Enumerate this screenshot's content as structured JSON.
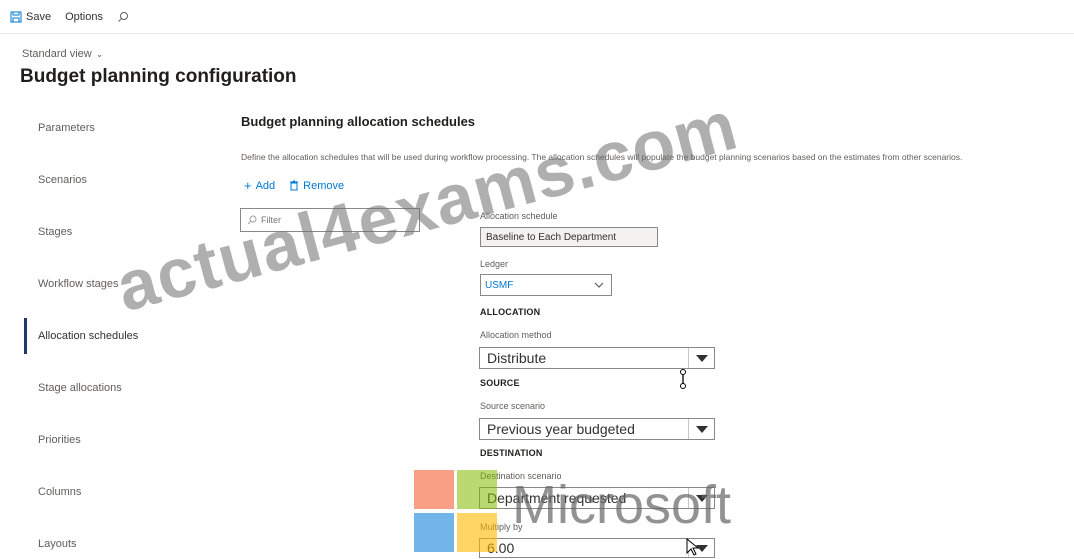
{
  "toolbar": {
    "save_label": "Save",
    "options_label": "Options"
  },
  "header": {
    "view_label": "Standard view",
    "title": "Budget planning configuration"
  },
  "nav": {
    "items": [
      {
        "label": "Parameters"
      },
      {
        "label": "Scenarios"
      },
      {
        "label": "Stages"
      },
      {
        "label": "Workflow stages"
      },
      {
        "label": "Allocation schedules"
      },
      {
        "label": "Stage allocations"
      },
      {
        "label": "Priorities"
      },
      {
        "label": "Columns"
      },
      {
        "label": "Layouts"
      }
    ],
    "active_item": "Allocation schedules"
  },
  "main": {
    "title": "Budget planning allocation schedules",
    "description": "Define the allocation schedules that will be used during workflow processing. The allocation schedules will populate the budget planning scenarios based on the estimates from other scenarios.",
    "add_label": "Add",
    "remove_label": "Remove",
    "filter_placeholder": "Filter"
  },
  "form": {
    "allocation_schedule_label": "Allocation schedule",
    "allocation_schedule_value": "Baseline to Each Department",
    "ledger_label": "Ledger",
    "ledger_value": "USMF",
    "allocation_header": "ALLOCATION",
    "allocation_method_label": "Allocation method",
    "allocation_method_value": "Distribute",
    "source_header": "SOURCE",
    "source_scenario_label": "Source scenario",
    "source_scenario_value": "Previous year budgeted",
    "destination_header": "DESTINATION",
    "destination_scenario_label": "Destination scenario",
    "destination_scenario_value": "Department requested",
    "multiply_by_label": "Multiply by",
    "multiply_by_value": "6.00"
  },
  "watermarks": {
    "text": "actual4exams.com",
    "logo_text": "Microsoft"
  },
  "colors": {
    "accent": "#0078d4",
    "nav_indicator": "#1f3864",
    "logo_red": "#f25022",
    "logo_green": "#7fba00",
    "logo_blue": "#00a4ef",
    "logo_yellow": "#ffb900"
  }
}
